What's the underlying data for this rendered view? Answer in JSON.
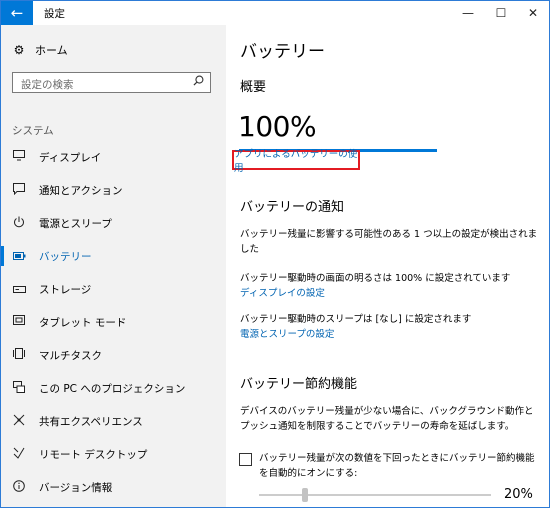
{
  "window": {
    "title": "設定",
    "back_icon": "←",
    "minimize_icon": "—",
    "maximize_icon": "☐",
    "close_icon": "✕",
    "accent_color": "#0078d7"
  },
  "sidebar": {
    "home_label": "ホーム",
    "search_placeholder": "設定の検索",
    "section_label": "システム",
    "items": [
      {
        "label": "ディスプレイ",
        "icon": "display-icon"
      },
      {
        "label": "通知とアクション",
        "icon": "notification-icon"
      },
      {
        "label": "電源とスリープ",
        "icon": "power-icon"
      },
      {
        "label": "バッテリー",
        "icon": "battery-icon",
        "active": true
      },
      {
        "label": "ストレージ",
        "icon": "storage-icon"
      },
      {
        "label": "タブレット モード",
        "icon": "tablet-icon"
      },
      {
        "label": "マルチタスク",
        "icon": "multitask-icon"
      },
      {
        "label": "この PC へのプロジェクション",
        "icon": "projection-icon"
      },
      {
        "label": "共有エクスペリエンス",
        "icon": "share-icon"
      },
      {
        "label": "リモート デスクトップ",
        "icon": "remote-desktop-icon"
      },
      {
        "label": "バージョン情報",
        "icon": "info-icon"
      }
    ]
  },
  "main": {
    "title": "バッテリー",
    "overview_heading": "概要",
    "battery_percent": "100%",
    "battery_level": 1.0,
    "usage_link": "アプリによるバッテリーの使用",
    "notification_heading": "バッテリーの通知",
    "notification_text": "バッテリー残量に影響する可能性のある 1 つ以上の設定が検出されました",
    "brightness_text": "バッテリー駆動時の画面の明るさは 100% に設定されています",
    "display_link": "ディスプレイの設定",
    "sleep_text": "バッテリー駆動時のスリープは [なし] に設定されます",
    "power_link": "電源とスリープの設定",
    "saver_heading": "バッテリー節約機能",
    "saver_text": "デバイスのバッテリー残量が少ない場合に、バックグラウンド動作とプッシュ通知を制限することでバッテリーの寿命を延ばします。",
    "auto_saver_label": "バッテリー残量が次の数値を下回ったときにバッテリー節約機能を自動的にオンにする:",
    "auto_saver_checked": false,
    "threshold_value": "20%",
    "threshold_level": 0.2
  }
}
